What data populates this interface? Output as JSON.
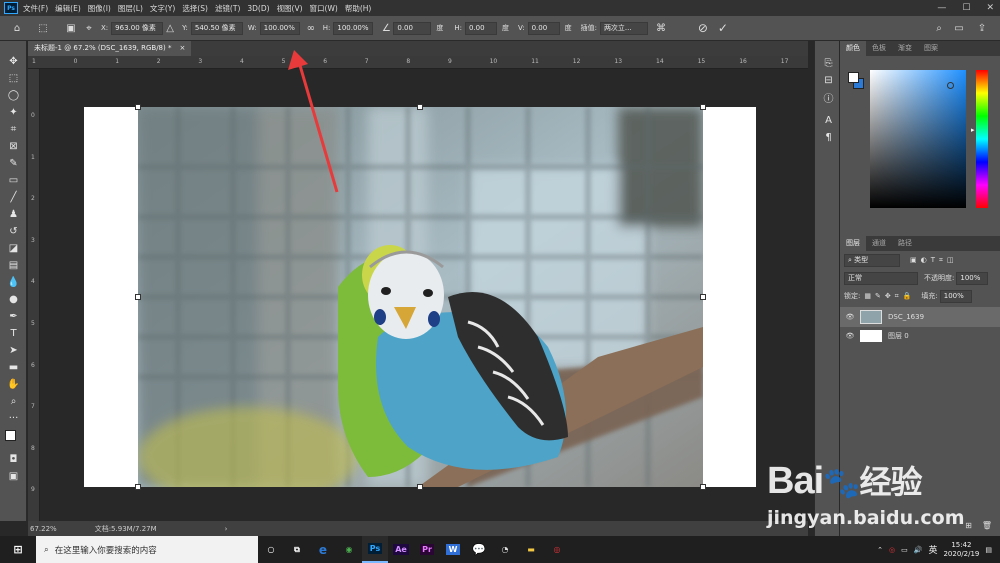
{
  "app": {
    "logo": "Ps"
  },
  "menu": [
    "文件(F)",
    "编辑(E)",
    "图像(I)",
    "图层(L)",
    "文字(Y)",
    "选择(S)",
    "滤镜(T)",
    "3D(D)",
    "视图(V)",
    "窗口(W)",
    "帮助(H)"
  ],
  "window_controls": {
    "minimize": "—",
    "maximize": "☐",
    "close": "✕"
  },
  "options": {
    "x_label": "X:",
    "x_value": "963.00 像素",
    "y_label": "Y:",
    "y_value": "540.50 像素",
    "w_label": "W:",
    "w_value": "100.00%",
    "h_label": "H:",
    "h_value": "100.00%",
    "angle_value": "0.00",
    "angle_unit": "度",
    "hskew_label": "H:",
    "hskew_value": "0.00",
    "hskew_unit": "度",
    "vskew_label": "V:",
    "vskew_value": "0.00",
    "vskew_unit": "度",
    "interp_label": "插值:",
    "interp_value": "两次立...",
    "link_icon": "link-icon"
  },
  "document": {
    "tab_title": "未标题-1 @ 67.2% (DSC_1639, RGB/8) *",
    "tab_close": "×",
    "zoom": "67.22%",
    "doc_info": "文档:5.93M/7.27M",
    "ruler_h_ticks": [
      "1",
      "0",
      "1",
      "2",
      "3",
      "4",
      "5",
      "6",
      "7",
      "8",
      "9",
      "10",
      "11",
      "12",
      "13",
      "14",
      "15",
      "16",
      "17"
    ],
    "ruler_v_ticks": [
      "0",
      "1",
      "2",
      "3",
      "4",
      "5",
      "6",
      "7",
      "8",
      "9"
    ]
  },
  "color_panel": {
    "tabs": [
      "颜色",
      "色板",
      "渐变",
      "图案"
    ],
    "fg_color": "#ffffff",
    "bg_color": "#2b7bd6",
    "hue_color": "#1e90ff"
  },
  "layers_panel": {
    "tabs": [
      "图层",
      "通道",
      "路径"
    ],
    "filter_label": "类型",
    "blend_mode": "正常",
    "opacity_label": "不透明度:",
    "opacity_value": "100%",
    "lock_label": "锁定:",
    "fill_label": "填充:",
    "fill_value": "100%",
    "layers": [
      {
        "name": "DSC_1639",
        "selected": true
      },
      {
        "name": "图层 0",
        "selected": false
      }
    ]
  },
  "taskbar": {
    "search_placeholder": "在这里输入你要搜索的内容",
    "apps": [
      "Ps",
      "Ae",
      "Pr",
      "W"
    ],
    "time": "15:42",
    "date": "2020/2/19",
    "ime": "英"
  },
  "watermark": {
    "brand": "Bai",
    "brand2": "经验",
    "url": "jingyan.baidu.com"
  }
}
